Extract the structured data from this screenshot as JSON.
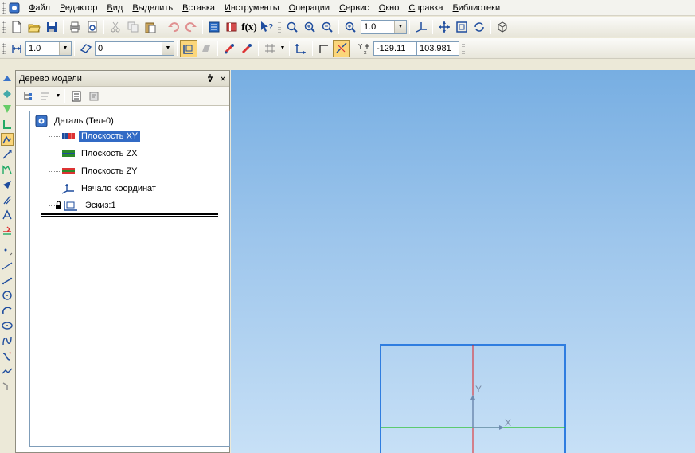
{
  "menu": {
    "items": [
      "Файл",
      "Редактор",
      "Вид",
      "Выделить",
      "Вставка",
      "Инструменты",
      "Операции",
      "Сервис",
      "Окно",
      "Справка",
      "Библиотеки"
    ]
  },
  "toolbar1": {
    "zoom_value": "1.0",
    "fx_label": "f(x)"
  },
  "toolbar2": {
    "step_value": "1.0",
    "layer_value": "0",
    "coord_x": "-129.11",
    "coord_y": "103.981"
  },
  "panel": {
    "title": "Дерево модели",
    "pin_glyph": "p",
    "close_glyph": "×"
  },
  "tree": {
    "root": "Деталь (Тел-0)",
    "items": [
      "Плоскость XY",
      "Плоскость ZX",
      "Плоскость ZY",
      "Начало координат",
      "Эскиз:1"
    ]
  },
  "viewport": {
    "axis_x_label": "X",
    "axis_y_label": "Y"
  },
  "colors": {
    "selection": "#316ac5",
    "sketch_blue": "#2f7de0",
    "axis_red": "#e02020",
    "axis_green": "#22c022",
    "viewport_top": "#77aee2",
    "viewport_bottom": "#c7e0f6"
  },
  "icons": {
    "menu": "app-part-icon",
    "toolbar1": [
      "new-document-icon",
      "open-icon",
      "save-icon",
      "print-icon",
      "print-preview-icon",
      "cut-icon",
      "copy-icon",
      "paste-icon",
      "undo-icon",
      "redo-icon",
      "manager-icon",
      "library-icon",
      "variables-icon",
      "help-cursor-icon",
      "zoom-window-icon",
      "zoom-in-icon",
      "zoom-out-icon",
      "zoom-scale-icon",
      "orientation-icon",
      "pan-icon",
      "zoom-fit-icon",
      "rotate-icon",
      "view-mode-icon"
    ],
    "toolbar2": [
      "step-cursor-icon",
      "layer-icon",
      "parametric-mode-icon",
      "geometry-icon",
      "snap-icon",
      "local-snap-icon",
      "grid-icon",
      "local-cs-icon",
      "ortho-icon",
      "round-icon",
      "point-snap-icon"
    ]
  }
}
